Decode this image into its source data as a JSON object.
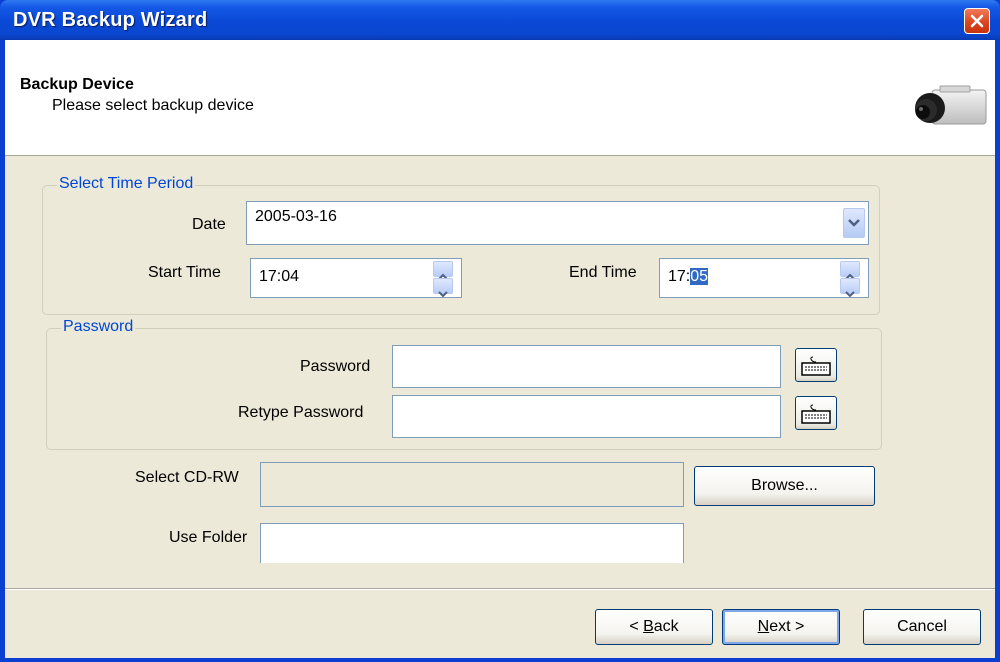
{
  "window": {
    "title": "DVR Backup Wizard"
  },
  "header": {
    "title": "Backup Device",
    "subtitle": "Please select backup device"
  },
  "time_period": {
    "group_label": "Select Time Period",
    "date_label": "Date",
    "date_value": "2005-03-16",
    "start_time_label": "Start Time",
    "start_time_value": "17:04",
    "end_time_label": "End Time",
    "end_time_hour": "17:",
    "end_time_minute": "05"
  },
  "password": {
    "group_label": "Password",
    "password_label": "Password",
    "password_value": "",
    "retype_label": "Retype Password",
    "retype_value": ""
  },
  "cdrw": {
    "label": "Select CD-RW",
    "value": "",
    "browse_label": "Browse..."
  },
  "folder": {
    "label": "Use Folder",
    "value": ""
  },
  "buttons": {
    "back_prefix": "< ",
    "back_mnemonic": "B",
    "back_rest": "ack",
    "next_mnemonic": "N",
    "next_rest": "ext >",
    "cancel": "Cancel"
  },
  "icons": {
    "close": "close-icon",
    "camera": "camera-icon",
    "keyboard": "keyboard-icon",
    "dropdown": "chevron-down-icon",
    "spin_up": "spin-up-icon",
    "spin_down": "spin-down-icon"
  }
}
